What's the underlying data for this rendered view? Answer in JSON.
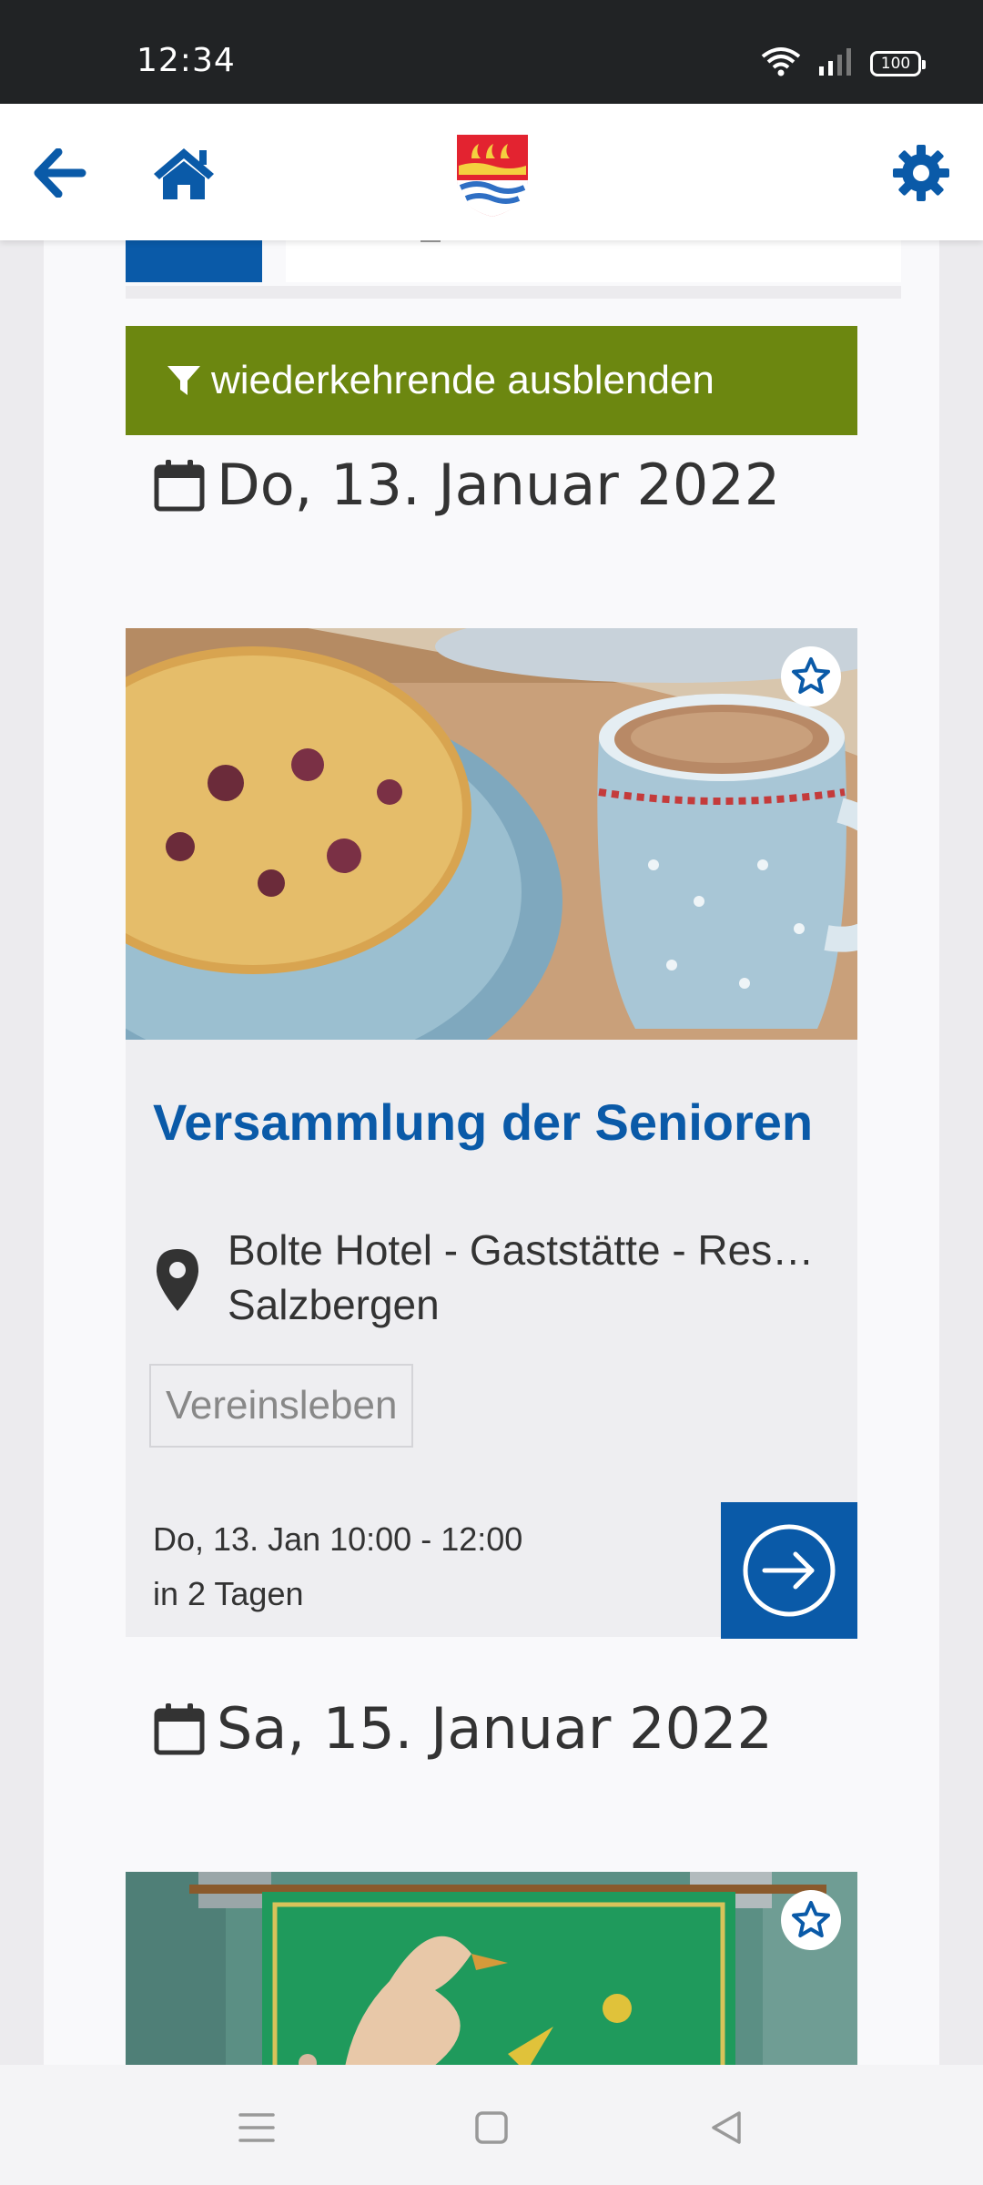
{
  "status_bar": {
    "time": "12:34",
    "battery": "100",
    "icons": [
      "wifi-icon",
      "signal-icon",
      "battery-icon"
    ]
  },
  "header": {
    "icons": [
      "arrow-left-icon",
      "home-icon",
      "coat-of-arms-logo",
      "gear-icon"
    ]
  },
  "filter": {
    "label": "wiederkehrende ausblenden",
    "icon": "filter-icon",
    "color": "#6c8710"
  },
  "events": [
    {
      "date_heading": "Do, 13. Januar 2022",
      "title": "Versammlung der Senioren",
      "location_line1": "Bolte Hotel - Gaststätte - Restaurant",
      "location_line2": "Salzbergen",
      "category": "Vereinsleben",
      "time": "Do, 13. Jan 10:00 - 12:00",
      "relative": "in 2 Tagen"
    },
    {
      "date_heading": "Sa, 15. Januar 2022"
    }
  ],
  "colors": {
    "primary": "#0a5aa8",
    "filter_green": "#6c8710",
    "status_bar": "#212325"
  },
  "nav": {
    "icons": [
      "menu-icon",
      "square-home-icon",
      "triangle-back-icon"
    ]
  }
}
